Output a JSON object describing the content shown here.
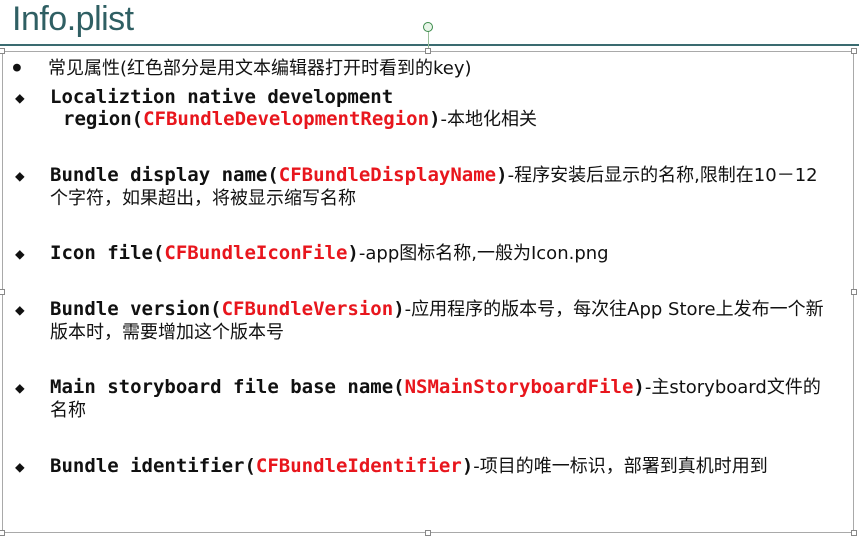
{
  "title": "Info.plist",
  "intro": {
    "bullet": "●",
    "text": "常见属性(红色部分是用文本编辑器打开时看到的key)"
  },
  "items": [
    {
      "bullet": "◆",
      "name_line1": "Localiztion native development",
      "name_line2_prefix": "region(",
      "key": "CFBundleDevelopmentRegion",
      "suffix": ")",
      "desc": "-本地化相关"
    },
    {
      "bullet": "◆",
      "name": "Bundle display name(",
      "key": "CFBundleDisplayName",
      "suffix": ")",
      "desc": "-程序安装后显示的名称,限制在10－12个字符，如果超出，将被显示缩写名称"
    },
    {
      "bullet": "◆",
      "name": "Icon file(",
      "key": "CFBundleIconFile",
      "suffix": ")",
      "desc": "-app图标名称,一般为Icon.png"
    },
    {
      "bullet": "◆",
      "name": "Bundle version(",
      "key": "CFBundleVersion",
      "suffix": ")",
      "desc": "-应用程序的版本号，每次往App Store上发布一个新版本时，需要增加这个版本号"
    },
    {
      "bullet": "◆",
      "name": "Main storyboard file base name(",
      "key": "NSMainStoryboardFile",
      "suffix": ")",
      "desc": "-主storyboard文件的名称"
    },
    {
      "bullet": "◆",
      "name": "Bundle identifier(",
      "key": "CFBundleIdentifier",
      "suffix": ")",
      "desc": "-项目的唯一标识，部署到真机时用到"
    }
  ],
  "colors": {
    "title": "#2f5f63",
    "key": "#e8161d",
    "rule": "#3a6b70"
  }
}
